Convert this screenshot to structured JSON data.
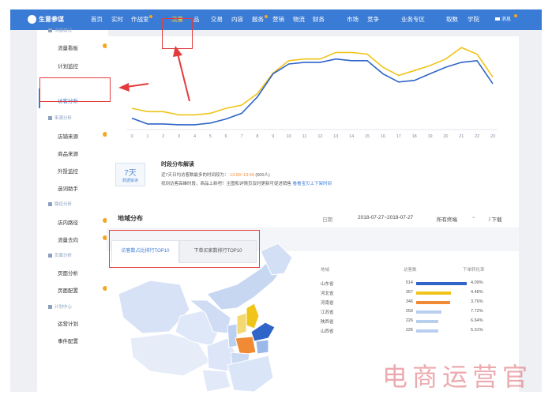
{
  "topbar": {
    "brand": "生意参谋",
    "nav": [
      "首页",
      "实时",
      "作战室",
      "流量",
      "品",
      "交易",
      "内容",
      "服务",
      "营销",
      "物流",
      "财务",
      "市场",
      "竞争",
      "业务专区",
      "取数",
      "学院",
      "消息"
    ],
    "active": "流量"
  },
  "sidebar": {
    "groups": [
      {
        "label": "流量概况",
        "items": [
          {
            "label": "流量看板",
            "dot": true
          },
          {
            "label": "计划监控",
            "dot": false
          },
          {
            "label": "访客分析",
            "dot": false,
            "active": true
          }
        ]
      },
      {
        "label": "来源分析",
        "items": [
          {
            "label": "店铺来源",
            "dot": true
          },
          {
            "label": "商品来源",
            "dot": false
          },
          {
            "label": "外投监控",
            "dot": false
          },
          {
            "label": "选词助手",
            "dot": false
          }
        ]
      },
      {
        "label": "路径分析",
        "items": [
          {
            "label": "店内路径",
            "dot": true
          },
          {
            "label": "流量去向",
            "dot": true
          }
        ]
      },
      {
        "label": "页面分析",
        "items": [
          {
            "label": "页面分析",
            "dot": false
          },
          {
            "label": "页面配置",
            "dot": true
          }
        ]
      },
      {
        "label": "计划中心",
        "items": [
          {
            "label": "运营计划",
            "dot": false
          },
          {
            "label": "事件配置",
            "dot": false
          }
        ]
      }
    ]
  },
  "chart_data": {
    "type": "line",
    "x": [
      0,
      1,
      2,
      3,
      4,
      5,
      6,
      7,
      8,
      9,
      10,
      11,
      12,
      13,
      14,
      15,
      16,
      17,
      18,
      19,
      20,
      21,
      22,
      23
    ],
    "ylim": [
      0,
      100
    ],
    "series": [
      {
        "values": [
          22,
          18,
          18,
          14,
          14,
          16,
          22,
          26,
          40,
          65,
          80,
          82,
          82,
          90,
          90,
          88,
          72,
          62,
          68,
          74,
          82,
          96,
          88,
          60
        ],
        "color": "#f0c419"
      },
      {
        "values": [
          10,
          3,
          3,
          2,
          2,
          4,
          9,
          16,
          36,
          64,
          76,
          78,
          78,
          82,
          80,
          80,
          64,
          54,
          56,
          64,
          72,
          78,
          80,
          52
        ],
        "color": "#2f64c8"
      }
    ]
  },
  "insight": {
    "day_number": "7天",
    "day_caption": "数据解读",
    "title": "时段分布解读",
    "line1": "近7天日均访客数最多的时间段为：",
    "line1_time": "13:00~13:59",
    "line1_count": "(500人)",
    "line2": "找到访客高峰时段，商品上新吧！主图和详情页及时更新可促进销售",
    "line2_link": "看看宝贝上下架时间"
  },
  "region": {
    "title": "地域分布",
    "date_label": "日期",
    "date_range": "2018-07-27~2018-07-27",
    "device": "所有终端",
    "download": "下载",
    "tabs": [
      "访客数占比排行TOP10",
      "下单买家数排行TOP10"
    ],
    "headers": [
      "地域",
      "访客数",
      "下单转化率"
    ],
    "rows": [
      {
        "province": "山东省",
        "visitors": 514,
        "rate": "4.09%",
        "color": "#2f64c8"
      },
      {
        "province": "河北省",
        "visitors": 357,
        "rate": "4.48%",
        "color": "#f0c419"
      },
      {
        "province": "河南省",
        "visitors": 346,
        "rate": "3.76%",
        "color": "#f08a35"
      },
      {
        "province": "江苏省",
        "visitors": 259,
        "rate": "7.72%",
        "color": "#b9cff0"
      },
      {
        "province": "陕西省",
        "visitors": 226,
        "rate": "6.64%",
        "color": "#b9cff0"
      },
      {
        "province": "山西省",
        "visitors": 226,
        "rate": "5.31%",
        "color": "#b9cff0"
      }
    ]
  },
  "watermark": "电商运营官"
}
